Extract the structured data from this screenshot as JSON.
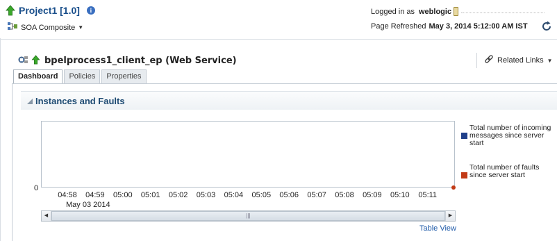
{
  "header": {
    "project_title": "Project1 [1.0]",
    "soa_menu_label": "SOA Composite",
    "logged_in_label": "Logged in as",
    "username": "weblogic",
    "page_refreshed_label": "Page Refreshed",
    "page_refreshed_value": "May 3, 2014 5:12:00 AM IST"
  },
  "service": {
    "title": "bpelprocess1_client_ep (Web Service)",
    "related_links_label": "Related Links"
  },
  "tabs": [
    {
      "label": "Dashboard",
      "active": true
    },
    {
      "label": "Policies",
      "active": false
    },
    {
      "label": "Properties",
      "active": false
    }
  ],
  "region": {
    "title": "Instances and Faults"
  },
  "chart_data": {
    "type": "line",
    "y_tick_label": "0",
    "x_ticks": [
      "04:58",
      "04:59",
      "05:00",
      "05:01",
      "05:02",
      "05:03",
      "05:04",
      "05:05",
      "05:06",
      "05:07",
      "05:08",
      "05:09",
      "05:10",
      "05:11"
    ],
    "x_date_label": "May 03 2014",
    "series": [
      {
        "name": "Total number of incoming messages since server start",
        "color": "#1f3f8a",
        "values": []
      },
      {
        "name": "Total number of faults since server start",
        "color": "#c23a16",
        "values": [
          0
        ]
      }
    ]
  },
  "legend": [
    {
      "text": "Total number of incoming messages since server start",
      "color": "#1f3f8a"
    },
    {
      "text": "Total number of faults since server start",
      "color": "#c23a16"
    }
  ],
  "table_view_label": "Table View",
  "scrollbar_grip": "|||"
}
